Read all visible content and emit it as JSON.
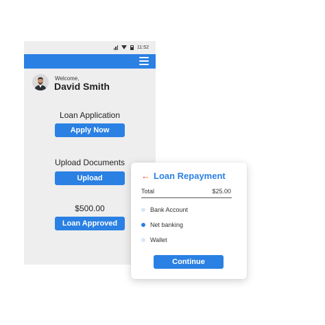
{
  "status_bar": {
    "time": "11:52",
    "icons": [
      "signal-icon",
      "wifi-icon",
      "battery-icon"
    ]
  },
  "app_bar": {
    "color": "#2a80e3",
    "menu_icon": "hamburger-menu-icon"
  },
  "user": {
    "greeting": "Welcome,",
    "name": "David Smith"
  },
  "sections": [
    {
      "label": "Loan Application",
      "button": "Apply Now"
    },
    {
      "label": "Upload Documents",
      "button": "Upload"
    },
    {
      "label": "$500.00",
      "button": "Loan Approved"
    }
  ],
  "repayment": {
    "back_icon": "back-arrow-icon",
    "title": "Loan Repayment",
    "total_label": "Total",
    "total_value": "$25.00",
    "options": [
      {
        "label": "Bank Account",
        "selected": false
      },
      {
        "label": "Net banking",
        "selected": true
      },
      {
        "label": "Wallet",
        "selected": false
      }
    ],
    "continue_label": "Continue"
  },
  "colors": {
    "primary": "#2a80e3",
    "accent_arrow": "#e8541f",
    "phone_background": "#eeeeee"
  }
}
